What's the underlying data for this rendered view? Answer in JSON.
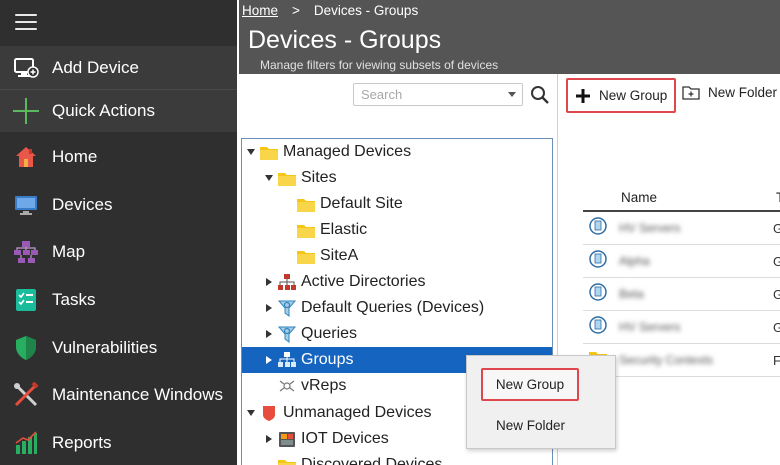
{
  "sidebar": {
    "add_device": "Add Device",
    "quick_actions": "Quick Actions",
    "items": [
      {
        "label": "Home",
        "icon": "house-icon"
      },
      {
        "label": "Devices",
        "icon": "monitor-icon"
      },
      {
        "label": "Map",
        "icon": "network-map-icon"
      },
      {
        "label": "Tasks",
        "icon": "checklist-icon"
      },
      {
        "label": "Vulnerabilities",
        "icon": "shield-icon"
      },
      {
        "label": "Maintenance Windows",
        "icon": "wrench-screwdriver-icon"
      },
      {
        "label": "Reports",
        "icon": "bar-chart-icon"
      }
    ]
  },
  "header": {
    "breadcrumb_home": "Home",
    "breadcrumb_sep": ">",
    "breadcrumb_current": "Devices - Groups",
    "title": "Devices - Groups",
    "subtitle": "Manage filters for viewing subsets of devices"
  },
  "search": {
    "placeholder": "Search"
  },
  "tree": {
    "nodes": [
      {
        "label": "Managed Devices"
      },
      {
        "label": "Sites"
      },
      {
        "label": "Default Site"
      },
      {
        "label": "Elastic"
      },
      {
        "label": "SiteA"
      },
      {
        "label": "Active Directories"
      },
      {
        "label": "Default Queries (Devices)"
      },
      {
        "label": "Queries"
      },
      {
        "label": "Groups"
      },
      {
        "label": "vReps"
      },
      {
        "label": "Unmanaged Devices"
      },
      {
        "label": "IOT Devices"
      },
      {
        "label": "Discovered Devices"
      }
    ]
  },
  "context_menu": {
    "new_group": "New Group",
    "new_folder": "New Folder"
  },
  "toolbar": {
    "new_group": "New Group",
    "new_folder": "New Folder"
  },
  "grid": {
    "col_name": "Name",
    "col_type": "T",
    "rows": [
      {
        "name": "HV Servers",
        "type": "G"
      },
      {
        "name": "Alpha",
        "type": "G"
      },
      {
        "name": "Beta",
        "type": "G"
      },
      {
        "name": "HV Servers",
        "type": "G"
      },
      {
        "name": "Security Contexts",
        "type": "F"
      }
    ]
  },
  "colors": {
    "sidebar_bg": "#2f2f2f",
    "header_bg": "#555555",
    "selected_row": "#1565c0",
    "highlight_border": "#e0474c"
  }
}
